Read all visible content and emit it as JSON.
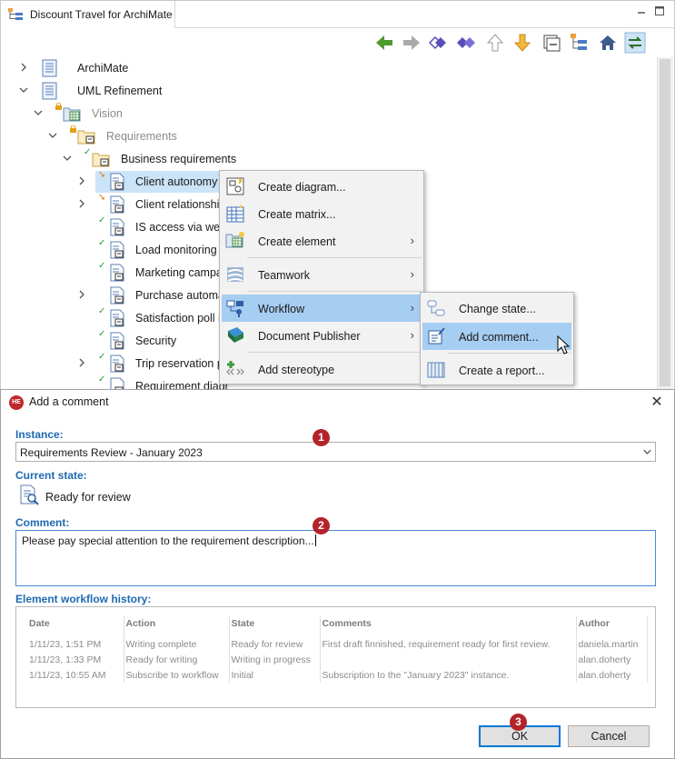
{
  "window": {
    "tab_title": "Discount Travel for ArchiMate"
  },
  "toolbar": {
    "icons": [
      "back-green-arrow-icon",
      "forward-gray-arrow-icon",
      "diamond-link-icon",
      "diamond-filled-icon",
      "up-arrow-icon",
      "down-arrow-icon",
      "collapse-icon",
      "tree-view-icon",
      "home-icon",
      "sync-icon"
    ]
  },
  "tree": {
    "items": [
      {
        "label": "ArchiMate"
      },
      {
        "label": "UML Refinement"
      },
      {
        "label": "Vision"
      },
      {
        "label": "Requirements"
      },
      {
        "label": "Business requirements"
      },
      {
        "label": "Client autonomy"
      },
      {
        "label": "Client relationship"
      },
      {
        "label": "IS access via websi"
      },
      {
        "label": "Load monitoring"
      },
      {
        "label": "Marketing campa"
      },
      {
        "label": "Purchase automa"
      },
      {
        "label": "Satisfaction poll r"
      },
      {
        "label": "Security"
      },
      {
        "label": "Trip reservation pr"
      },
      {
        "label": "Requirement diagr"
      }
    ]
  },
  "context_menu": {
    "items": [
      {
        "label": "Create diagram...",
        "has_submenu": false
      },
      {
        "label": "Create matrix...",
        "has_submenu": false
      },
      {
        "label": "Create element",
        "has_submenu": true
      },
      {
        "label": "Teamwork",
        "has_submenu": true
      },
      {
        "label": "Workflow",
        "has_submenu": true
      },
      {
        "label": "Document Publisher",
        "has_submenu": true
      },
      {
        "label": "Add stereotype",
        "has_submenu": false
      }
    ],
    "submenu_arrow": "›"
  },
  "workflow_submenu": {
    "items": [
      {
        "label": "Change state..."
      },
      {
        "label": "Add comment..."
      },
      {
        "label": "Create a report..."
      }
    ]
  },
  "dialog": {
    "title": "Add a comment",
    "icon_text": "HE",
    "close_glyph": "✕",
    "instance_label": "Instance:",
    "instance_value": "Requirements Review - January 2023",
    "current_state_label": "Current state:",
    "current_state_value": "Ready for review",
    "comment_label": "Comment:",
    "comment_value": "Please pay special attention to the requirement description...",
    "history_label": "Element workflow history:",
    "history": {
      "columns": [
        "Date",
        "Action",
        "State",
        "Comments",
        "Author"
      ],
      "rows": [
        [
          "1/11/23, 1:51 PM",
          "Writing complete",
          "Ready for review",
          "First draft finnished, requirement ready for first review.",
          "daniela.martin"
        ],
        [
          "1/11/23, 1:33 PM",
          "Ready for writing",
          "Writing in progress",
          "",
          "alan.doherty"
        ],
        [
          "1/11/23, 10:55 AM",
          "Subscribe to workflow",
          "Initial",
          "Subscription to the \"January 2023\" instance.",
          "alan.doherty"
        ]
      ]
    },
    "ok_label": "OK",
    "cancel_label": "Cancel"
  },
  "badges": [
    "1",
    "2",
    "3"
  ],
  "colors": {
    "accent_label": "#1d6ab2",
    "menu_highlight": "#a6cdf2",
    "badge": "#b3242a",
    "check": "#2b9a3e"
  }
}
